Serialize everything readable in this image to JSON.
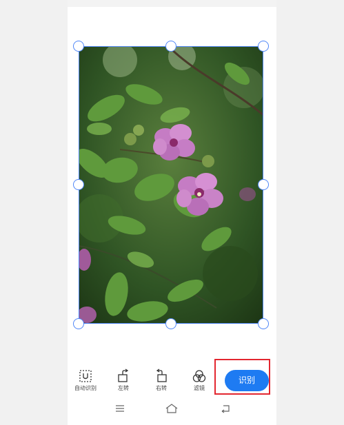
{
  "toolbar": {
    "items": [
      {
        "label": "自动识别",
        "icon": "auto-detect-icon"
      },
      {
        "label": "左转",
        "icon": "rotate-left-icon"
      },
      {
        "label": "右转",
        "icon": "rotate-right-icon"
      },
      {
        "label": "滤镜",
        "icon": "filter-icon"
      }
    ],
    "primary_label": "识别"
  },
  "navbar": {
    "icons": [
      "menu-icon",
      "home-icon",
      "back-icon"
    ]
  },
  "colors": {
    "accent": "#1e7bf2",
    "frame": "#4f86f7",
    "highlight": "#e3262f"
  }
}
